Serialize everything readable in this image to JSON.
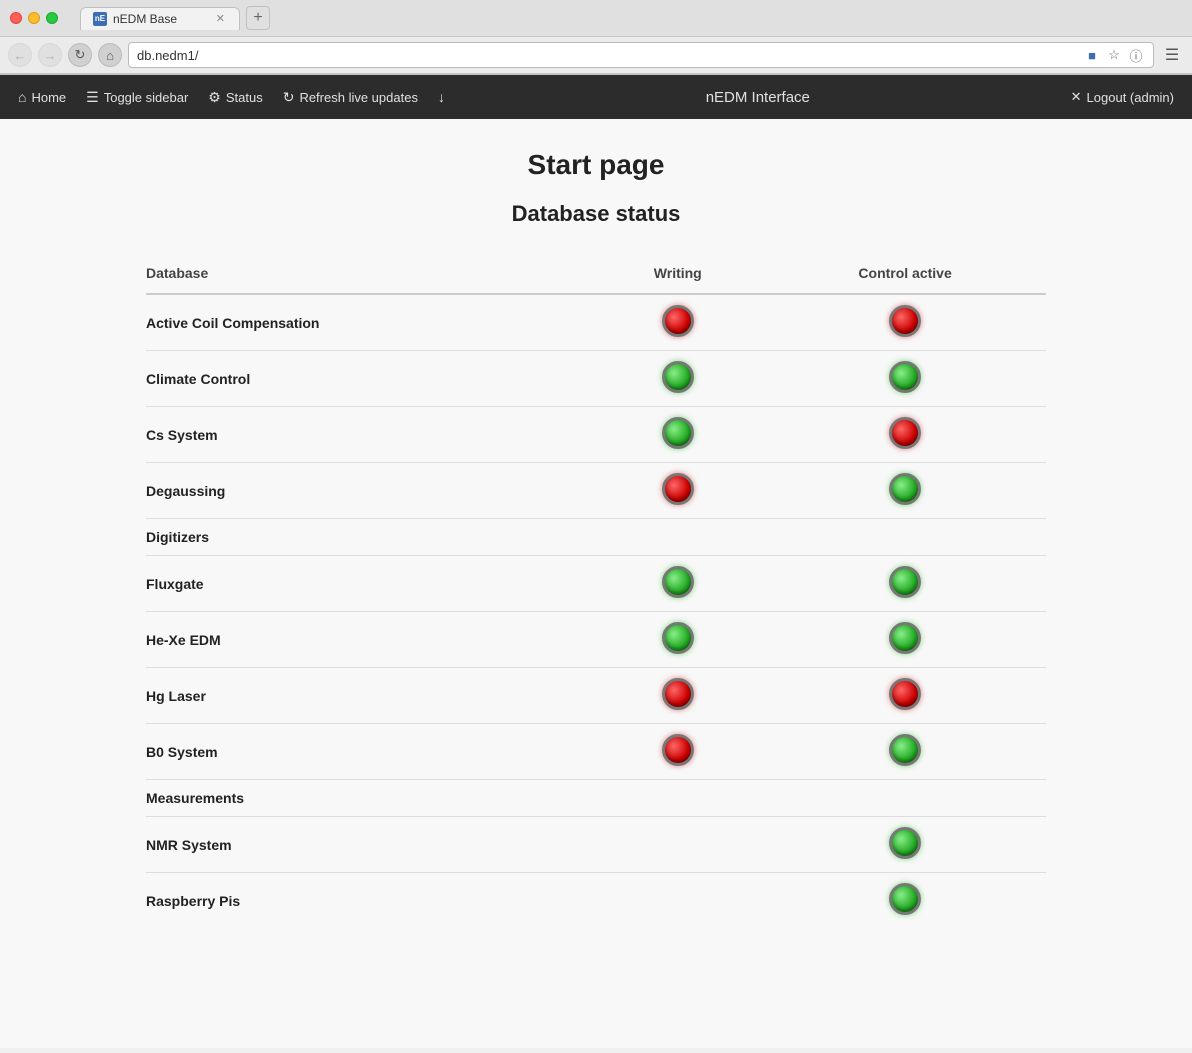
{
  "browser": {
    "tab_favicon": "nE",
    "tab_title": "nEDM Base",
    "address": "db.nedm1/",
    "new_tab_symbol": "+"
  },
  "navbar": {
    "home_label": "Home",
    "toggle_sidebar_label": "Toggle sidebar",
    "status_label": "Status",
    "refresh_label": "Refresh live updates",
    "download_label": "↓",
    "brand_label": "nEDM Interface",
    "logout_label": "Logout (admin)"
  },
  "page": {
    "title": "Start page",
    "section_title": "Database status",
    "table": {
      "col_database": "Database",
      "col_writing": "Writing",
      "col_control": "Control active",
      "rows": [
        {
          "name": "Active Coil Compensation",
          "writing": "red",
          "control": "red"
        },
        {
          "name": "Climate Control",
          "writing": "green",
          "control": "green"
        },
        {
          "name": "Cs System",
          "writing": "green",
          "control": "red"
        },
        {
          "name": "Degaussing",
          "writing": "red",
          "control": "green"
        },
        {
          "name": "Digitizers",
          "writing": "",
          "control": ""
        },
        {
          "name": "Fluxgate",
          "writing": "green",
          "control": "green"
        },
        {
          "name": "He-Xe EDM",
          "writing": "green",
          "control": "green"
        },
        {
          "name": "Hg Laser",
          "writing": "red",
          "control": "red"
        },
        {
          "name": "B0 System",
          "writing": "red",
          "control": "green"
        },
        {
          "name": "Measurements",
          "writing": "",
          "control": ""
        },
        {
          "name": "NMR System",
          "writing": "",
          "control": "green"
        },
        {
          "name": "Raspberry Pis",
          "writing": "",
          "control": "green"
        }
      ]
    }
  }
}
